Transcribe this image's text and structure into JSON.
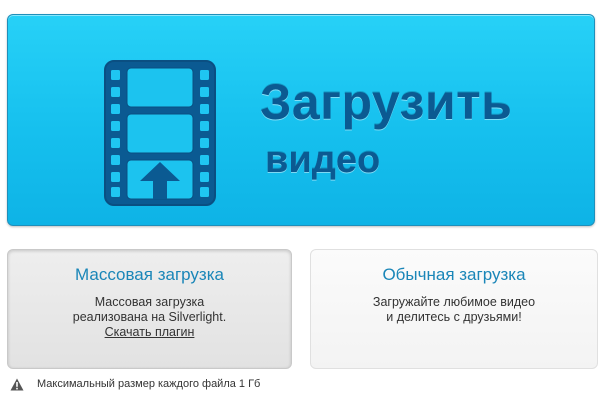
{
  "upload_button": {
    "title": "Загрузить",
    "subtitle": "видео",
    "icon": "film-upload-icon"
  },
  "bulk_upload": {
    "title": "Массовая загрузка",
    "line1": "Массовая загрузка",
    "line2": "реализована на Silverlight.",
    "link": "Скачать плагин"
  },
  "simple_upload": {
    "title": "Обычная загрузка",
    "line1": "Загружайте любимое видео",
    "line2": "и делитесь с друзьями!"
  },
  "footer": {
    "icon": "warning-icon",
    "text": "Максимальный размер каждого файла 1 Гб"
  },
  "colors": {
    "upload_bg": "#16c0ee",
    "upload_text": "#0b5a92",
    "panel_title": "#1a86b8"
  }
}
